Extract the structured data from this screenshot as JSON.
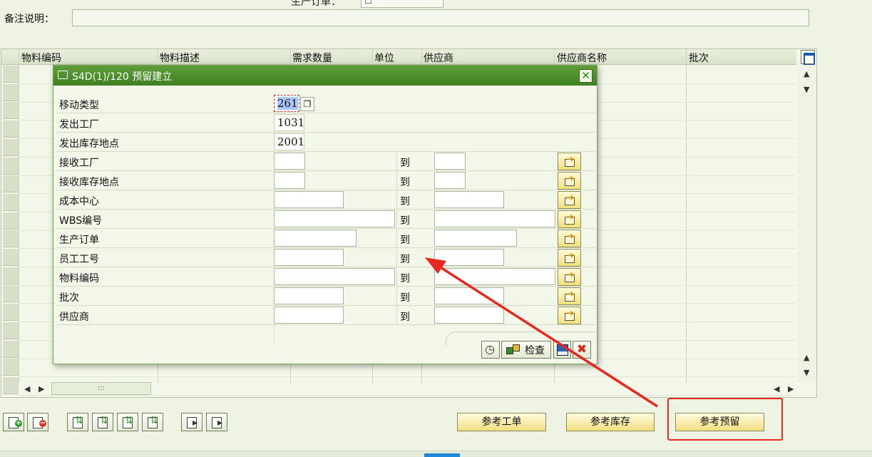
{
  "top_peek": {
    "label": "生产订单："
  },
  "remark": {
    "label": "备注说明：",
    "value": ""
  },
  "grid": {
    "columns": [
      "物料编码",
      "物料描述",
      "需求数量",
      "单位",
      "供应商",
      "供应商名称",
      "批次"
    ],
    "hscroll_handle": ":::"
  },
  "dialog": {
    "title": "S4D(1)/120 预留建立",
    "close_glyph": "✕",
    "fields": {
      "movement_type": {
        "label": "移动类型",
        "value": "261"
      },
      "issue_plant": {
        "label": "发出工厂",
        "value": "1031"
      },
      "issue_sloc": {
        "label": "发出库存地点",
        "value": "2001"
      },
      "recv_plant": {
        "label": "接收工厂",
        "to": "到"
      },
      "recv_sloc": {
        "label": "接收库存地点",
        "to": "到"
      },
      "cost_center": {
        "label": "成本中心",
        "to": "到"
      },
      "wbs": {
        "label": "WBS编号",
        "to": "到"
      },
      "prod_order": {
        "label": "生产订单",
        "to": "到"
      },
      "employee": {
        "label": "员工工号",
        "to": "到"
      },
      "material": {
        "label": "物料编码",
        "to": "到"
      },
      "batch": {
        "label": "批次",
        "to": "到"
      },
      "vendor": {
        "label": "供应商",
        "to": "到"
      }
    },
    "footer": {
      "check_label": "检查",
      "cancel_glyph": "✖"
    }
  },
  "bottom_buttons": {
    "ref_work_order": "参考工单",
    "ref_stock": "参考库存",
    "ref_reservation": "参考预留"
  },
  "colors": {
    "dialog_title": "#4a8b2b",
    "highlight_red": "#e8281e"
  }
}
